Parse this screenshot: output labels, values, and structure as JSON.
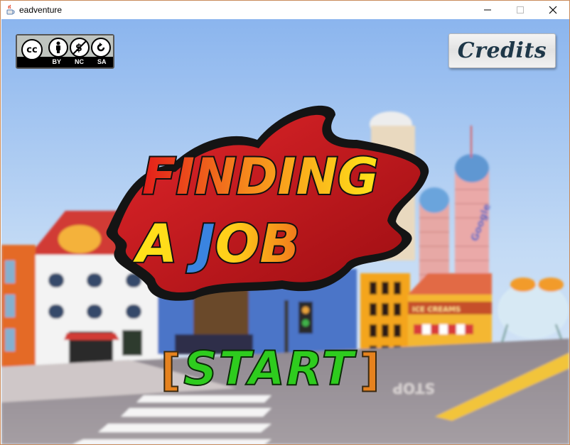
{
  "window": {
    "title": "eadventure",
    "app_icon": "java-cup-icon",
    "controls": [
      "minimize-icon",
      "maximize-icon",
      "close-icon"
    ]
  },
  "game": {
    "license_badge": {
      "main": "cc",
      "labels": [
        "BY",
        "NC",
        "SA"
      ]
    },
    "credits_label": "Credits",
    "title_line1": "FINDING",
    "title_line2_a": "A ",
    "title_line2_j": "J",
    "title_line2_rest": "OB",
    "start_label": "START",
    "bracket_left": "[",
    "bracket_right": "]",
    "scenery": {
      "shop_sign": "ICE CREAMS",
      "road_text": "STOP",
      "tower_logo": "Google"
    },
    "colors": {
      "sky_top": "#8bb5ee",
      "logo_splat": "#c0141a",
      "start_green": "#2ecc1e",
      "bracket_orange": "#e6821e",
      "credits_text": "#1e3748"
    }
  }
}
